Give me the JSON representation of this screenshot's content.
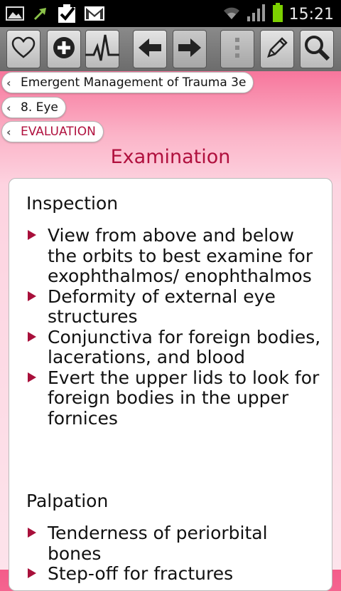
{
  "statusbar": {
    "time": "15:21",
    "icons": [
      "image-icon",
      "sync-icon",
      "checkbox-icon",
      "gmail-icon",
      "wifi-icon",
      "signal-icon",
      "battery-icon"
    ]
  },
  "toolbar": {
    "buttons": [
      {
        "name": "favorites",
        "icon": "heart-icon"
      },
      {
        "name": "add",
        "icon": "plus-circle-icon"
      },
      {
        "name": "monitor",
        "icon": "heartbeat-icon"
      },
      {
        "name": "back",
        "icon": "arrow-left-icon"
      },
      {
        "name": "forward",
        "icon": "arrow-right-icon"
      },
      {
        "name": "more",
        "icon": "vertical-dots-icon"
      },
      {
        "name": "edit",
        "icon": "pencil-icon"
      },
      {
        "name": "search",
        "icon": "magnifier-icon"
      }
    ]
  },
  "breadcrumbs": [
    {
      "label": "Emergent Management of Trauma 3e"
    },
    {
      "label": "8. Eye"
    },
    {
      "label": "EVALUATION"
    }
  ],
  "page": {
    "title": "Examination"
  },
  "content": {
    "sections": [
      {
        "heading": "Inspection",
        "items": [
          "View from above and below the orbits to best examine for exophthalmos/ enophthalmos",
          "Deformity of external eye structures",
          "Conjunctiva for foreign bodies, lacerations, and blood",
          "Evert the upper lids to look for foreign bodies in the upper fornices"
        ]
      },
      {
        "heading": "Palpation",
        "items": [
          "Tenderness of periorbital bones",
          "Step-off for fractures"
        ]
      }
    ]
  },
  "colors": {
    "accent": "#b0103e",
    "background_top": "#f45c8a",
    "background_bottom": "#fde3eb"
  }
}
